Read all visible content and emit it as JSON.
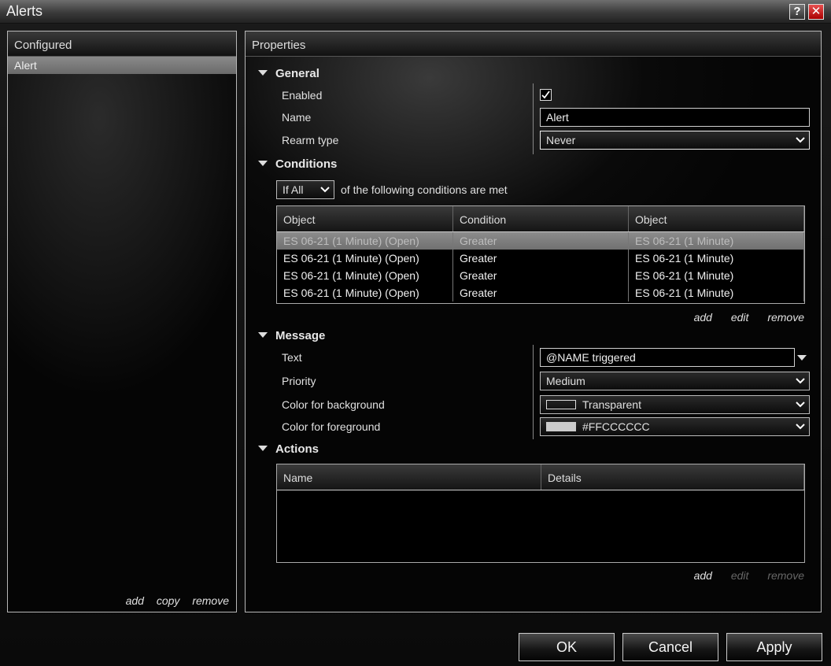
{
  "window": {
    "title": "Alerts"
  },
  "titlebar": {
    "help_label": "?",
    "close_label": "✕"
  },
  "left": {
    "header": "Configured",
    "items": [
      "Alert"
    ],
    "links": {
      "add": "add",
      "copy": "copy",
      "remove": "remove"
    }
  },
  "right": {
    "header": "Properties",
    "general": {
      "title": "General",
      "enabled_label": "Enabled",
      "enabled_checked": true,
      "name_label": "Name",
      "name_value": "Alert",
      "rearm_label": "Rearm type",
      "rearm_value": "Never"
    },
    "conditions": {
      "title": "Conditions",
      "match_value": "If All",
      "match_text": "of the following conditions are met",
      "columns": [
        "Object",
        "Condition",
        "Object"
      ],
      "rows": [
        [
          "ES 06-21 (1 Minute) (Open)",
          "Greater",
          "ES 06-21 (1 Minute)"
        ],
        [
          "ES 06-21 (1 Minute) (Open)",
          "Greater",
          "ES 06-21 (1 Minute)"
        ],
        [
          "ES 06-21 (1 Minute) (Open)",
          "Greater",
          "ES 06-21 (1 Minute)"
        ],
        [
          "ES 06-21 (1 Minute) (Open)",
          "Greater",
          "ES 06-21 (1 Minute)"
        ]
      ],
      "links": {
        "add": "add",
        "edit": "edit",
        "remove": "remove"
      }
    },
    "message": {
      "title": "Message",
      "text_label": "Text",
      "text_value": "@NAME triggered",
      "priority_label": "Priority",
      "priority_value": "Medium",
      "bg_label": "Color for background",
      "bg_value": "Transparent",
      "fg_label": "Color for foreground",
      "fg_value": "#FFCCCCCC",
      "fg_swatch_color": "#cccccc"
    },
    "actions": {
      "title": "Actions",
      "columns": [
        "Name",
        "Details"
      ],
      "links": {
        "add": "add",
        "edit": "edit",
        "remove": "remove"
      }
    }
  },
  "buttons": {
    "ok": "OK",
    "cancel": "Cancel",
    "apply": "Apply"
  }
}
